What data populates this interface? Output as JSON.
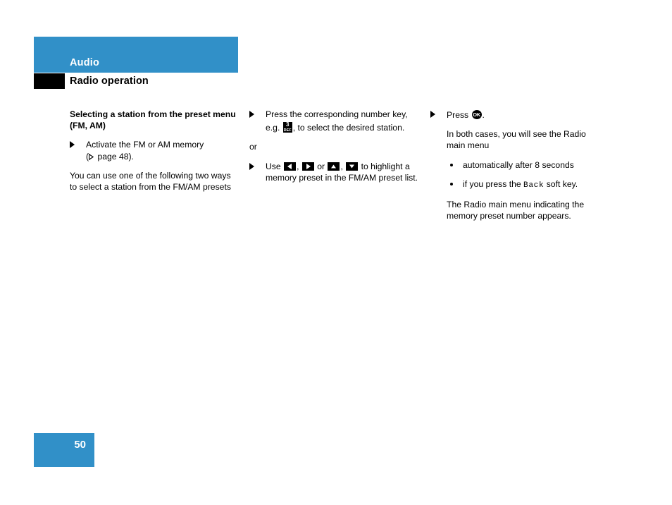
{
  "header": {
    "chapter_title": "Audio",
    "section_title": "Radio operation",
    "accent_color": "#3190c8",
    "rule_color": "#000000"
  },
  "columns": {
    "col1": {
      "sub_head": "Selecting a station from the preset menu (FM, AM)",
      "step1_text": "Activate the FM or AM memory",
      "step1_ref_prefix": "(",
      "step1_ref_icon": "reference-triangle-icon",
      "step1_ref_text": " page 48).",
      "para": "You can use one of the following two ways to select a station from the FM/AM presets"
    },
    "col2": {
      "step1_part1": "Press the corresponding number key, e.g. ",
      "step1_key": {
        "icon": "number-key-3-icon",
        "digit": "3",
        "letters": "DEF"
      },
      "step1_part2": ", to select the desired station.",
      "or_label": "or",
      "step2_part1": "Use ",
      "step2_key1": {
        "icon": "arrow-left-key-icon",
        "direction": "left"
      },
      "step2_sep1": ", ",
      "step2_key2": {
        "icon": "arrow-right-key-icon",
        "direction": "right"
      },
      "step2_sep2": " or ",
      "step2_key3": {
        "icon": "arrow-up-key-icon",
        "direction": "up"
      },
      "step2_sep3": ", ",
      "step2_key4": {
        "icon": "arrow-down-key-icon",
        "direction": "down"
      },
      "step2_part2": " to highlight a memory preset in the FM/AM preset list."
    },
    "col3": {
      "step1_part1": "Press ",
      "step1_key": {
        "icon": "ok-button-icon",
        "label": "OK"
      },
      "step1_part2": ".",
      "para1": "In both cases, you will see the Radio main menu",
      "bullets": [
        {
          "text": "automatically after 8 seconds"
        },
        {
          "prefix": "if you press the ",
          "key_label": "Back",
          "suffix": " soft key."
        }
      ],
      "para2": "The Radio main menu indicating the memory preset number appears."
    }
  },
  "footer": {
    "page_number": "50",
    "accent_color": "#3190c8"
  }
}
